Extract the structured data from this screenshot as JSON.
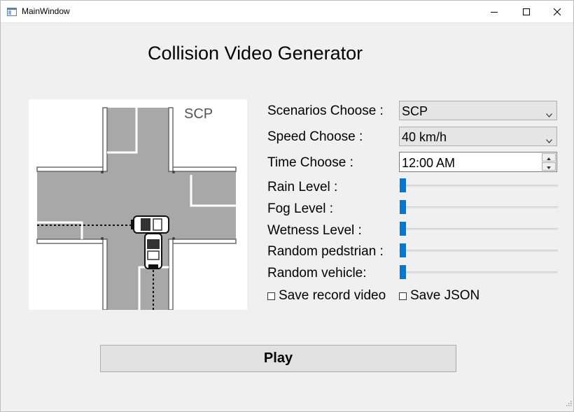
{
  "window": {
    "title": "MainWindow",
    "minimize_icon": "minimize-icon",
    "maximize_icon": "maximize-icon",
    "close_icon": "close-icon"
  },
  "header": {
    "title": "Collision Video Generator"
  },
  "preview": {
    "scenario_label": "SCP"
  },
  "form": {
    "scenario": {
      "label": "Scenarios Choose :",
      "value": "SCP"
    },
    "speed": {
      "label": "Speed Choose :",
      "value": "40 km/h"
    },
    "time": {
      "label": "Time Choose :",
      "value": "12:00 AM"
    },
    "rain": {
      "label": "Rain Level :",
      "value": 0
    },
    "fog": {
      "label": "Fog Level :",
      "value": 0
    },
    "wetness": {
      "label": "Wetness Level :",
      "value": 0
    },
    "pedestrian": {
      "label": "Random pedstrian :",
      "value": 0
    },
    "vehicle": {
      "label": "Random vehicle:",
      "value": 0
    },
    "save_video": {
      "label": "Save record video",
      "checked": false
    },
    "save_json": {
      "label": "Save JSON",
      "checked": false
    }
  },
  "actions": {
    "play_label": "Play"
  },
  "colors": {
    "accent": "#0078d7",
    "road": "#a8a8a8"
  }
}
